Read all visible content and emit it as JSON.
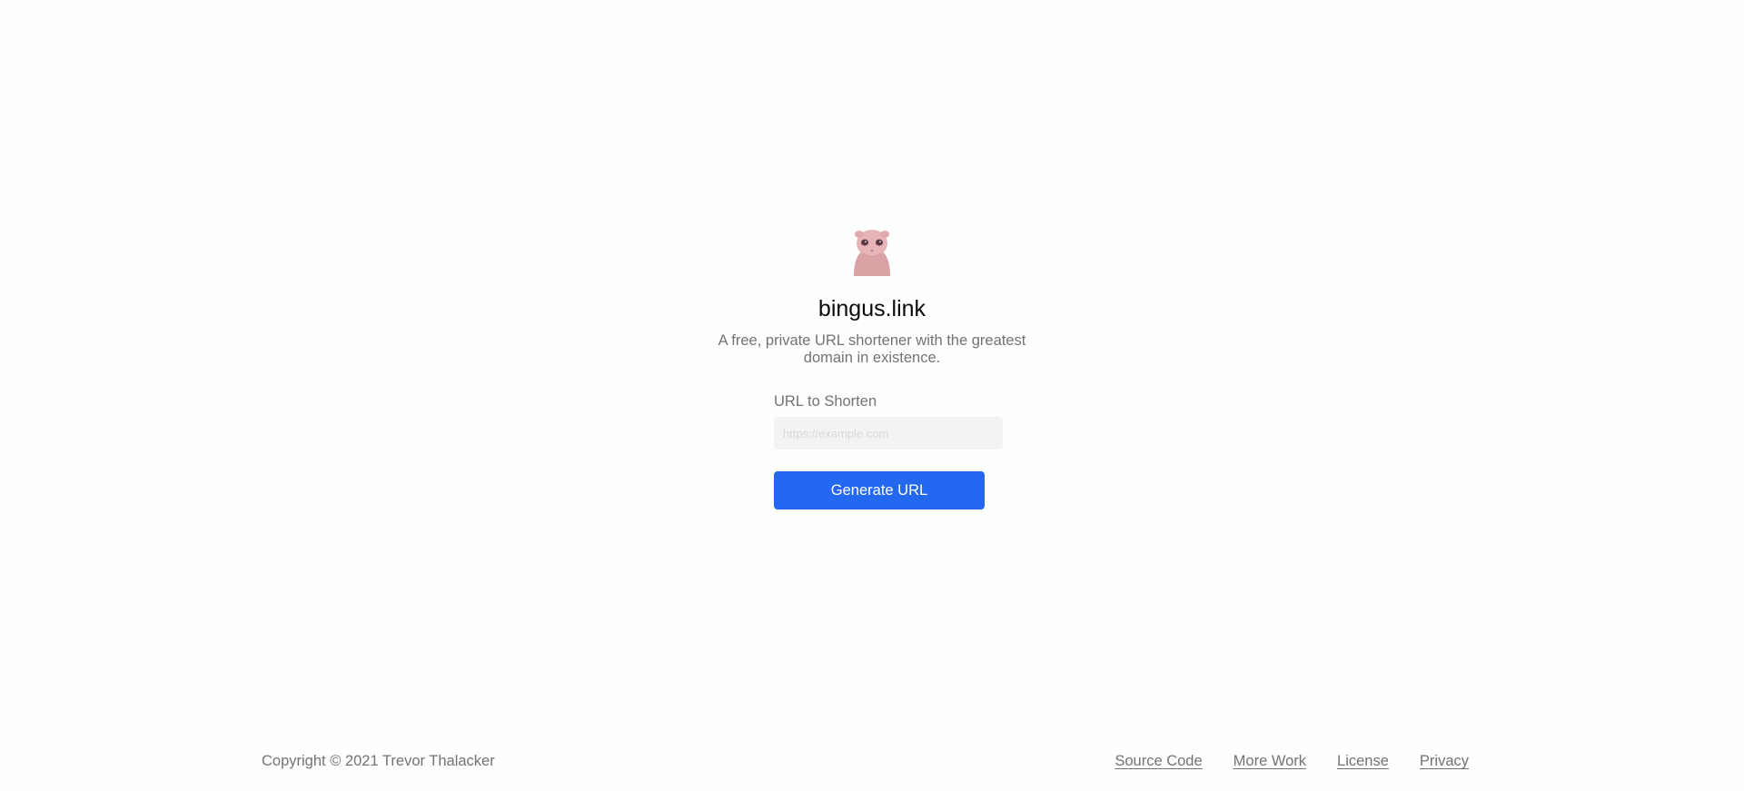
{
  "hero": {
    "title": "bingus.link",
    "tagline": "A free, private URL shortener with the greatest domain in existence.",
    "logo_icon": "bingus-cat-logo"
  },
  "form": {
    "label": "URL to Shorten",
    "input_value": "",
    "input_placeholder": "https://example.com",
    "submit_label": "Generate URL"
  },
  "footer": {
    "copyright": "Copyright © 2021 Trevor Thalacker",
    "links": [
      {
        "label": "Source Code"
      },
      {
        "label": "More Work"
      },
      {
        "label": "License"
      },
      {
        "label": "Privacy"
      }
    ]
  },
  "colors": {
    "accent": "#2468f2",
    "muted_text": "#737373",
    "input_bg": "#f3f3f3"
  }
}
